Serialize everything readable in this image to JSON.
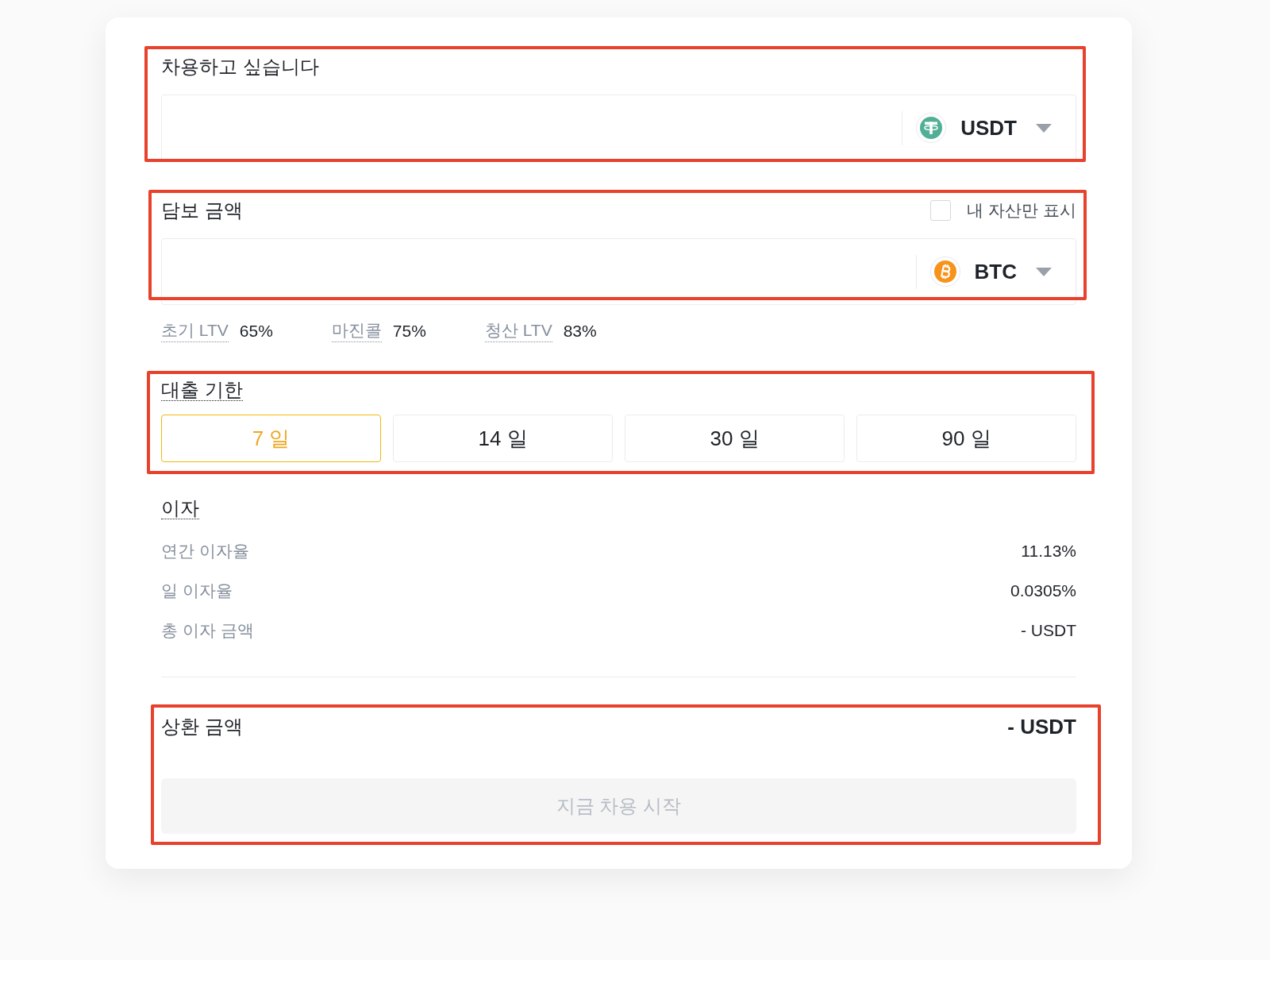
{
  "borrow": {
    "title": "차용하고 싶습니다",
    "highlighted": true,
    "coin": {
      "symbol": "USDT",
      "kind": "tether"
    }
  },
  "collateral": {
    "title": "담보 금액",
    "highlighted": true,
    "show_my_assets": {
      "label": "내 자산만 표시",
      "checked": false
    },
    "coin": {
      "symbol": "BTC",
      "kind": "bitcoin"
    }
  },
  "ltv": [
    {
      "label": "초기 LTV",
      "value": "65%"
    },
    {
      "label": "마진콜",
      "value": "75%"
    },
    {
      "label": "청산 LTV",
      "value": "83%"
    }
  ],
  "term": {
    "title": "대출 기한",
    "tooltip": true,
    "highlighted": true,
    "options": [
      {
        "label": "7 일",
        "selected": true
      },
      {
        "label": "14 일",
        "selected": false
      },
      {
        "label": "30 일",
        "selected": false
      },
      {
        "label": "90 일",
        "selected": false
      }
    ]
  },
  "interest": {
    "title": "이자",
    "tooltip": true,
    "rows": [
      {
        "label": "연간 이자율",
        "value": "11.13%"
      },
      {
        "label": "일 이자율",
        "value": "0.0305%"
      },
      {
        "label": "총 이자 금액",
        "value": "- USDT"
      }
    ]
  },
  "repayment": {
    "title": "상환 금액",
    "value": "- USDT",
    "highlighted": true,
    "button": {
      "label": "지금 차용 시작",
      "disabled": true
    }
  }
}
